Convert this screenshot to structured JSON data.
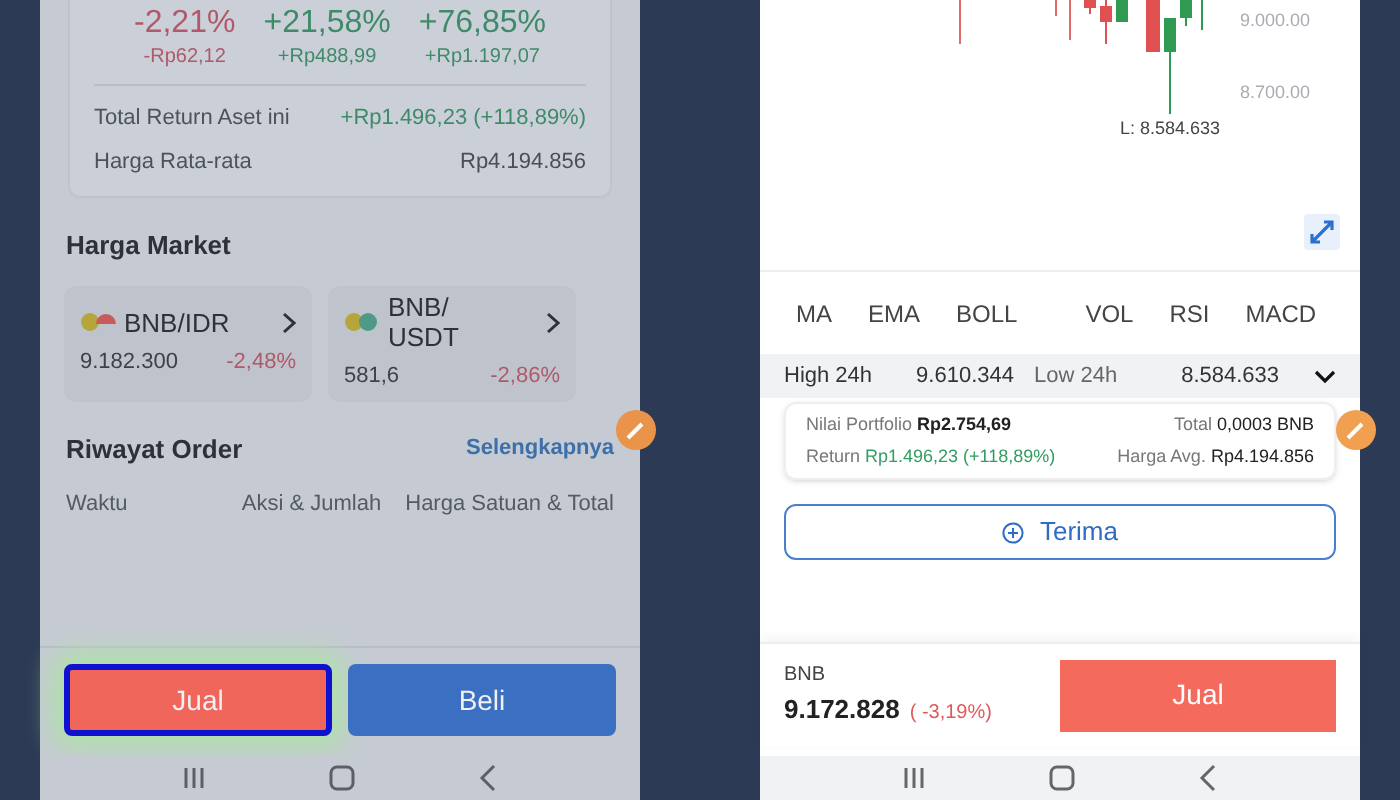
{
  "left_screen": {
    "return_columns": [
      {
        "percent": "-2,21%",
        "amount": "-Rp62,12",
        "kind": "loss"
      },
      {
        "percent": "+21,58%",
        "amount": "+Rp488,99",
        "kind": "gain"
      },
      {
        "percent": "+76,85%",
        "amount": "+Rp1.197,07",
        "kind": "gain"
      }
    ],
    "summary_rows": [
      {
        "label": "Total Return Aset ini",
        "value": "+Rp1.496,23 (+118,89%)",
        "kind": "gain"
      },
      {
        "label": "Harga Rata-rata",
        "value": "Rp4.194.856",
        "kind": "plain"
      }
    ],
    "market_title": "Harga Market",
    "markets": [
      {
        "pair": "BNB/IDR",
        "price": "9.182.300",
        "change": {
          "text": "-2,48%",
          "kind": "loss"
        },
        "kind": "fiat"
      },
      {
        "pair": "BNB/ USDT",
        "price": "581,6",
        "change": {
          "text": "-2,86%",
          "kind": "loss"
        },
        "kind": "stablecoin"
      }
    ],
    "order_history": {
      "title": "Riwayat Order",
      "link": "Selengkapnya",
      "columns": [
        "Waktu",
        "Aksi & Jumlah",
        "Harga Satuan & Total"
      ]
    },
    "buttons": [
      {
        "label": "Jual",
        "kind": "sell",
        "highlighted": true
      },
      {
        "label": "Beli",
        "kind": "buy",
        "highlighted": false
      }
    ]
  },
  "right_screen": {
    "price_axis_labels": [
      "9.000.00",
      "8.700.00"
    ],
    "low_marker": "L: 8.584.633",
    "indicator_tabs": [
      [
        "MA",
        "EMA",
        "BOLL"
      ],
      [
        "VOL",
        "RSI",
        "MACD"
      ]
    ],
    "stats": [
      {
        "label": "High 24h",
        "value": "9.610.344"
      },
      {
        "label": "Low 24h",
        "value": "8.584.633"
      }
    ],
    "portfolio": {
      "value_label": "Nilai Portfolio",
      "value": "Rp2.754,69",
      "total_label": "Total",
      "total": "0,0003 BNB",
      "return_label": "Return",
      "return": "Rp1.496,23 (+118,89%)",
      "avg_label": "Harga Avg.",
      "avg": "Rp4.194.856"
    },
    "receive_button": "Terima",
    "footer": {
      "symbol": "BNB",
      "price": "9.172.828",
      "change": {
        "text": "( -3,19%)",
        "kind": "loss"
      },
      "button": "Jual"
    }
  }
}
